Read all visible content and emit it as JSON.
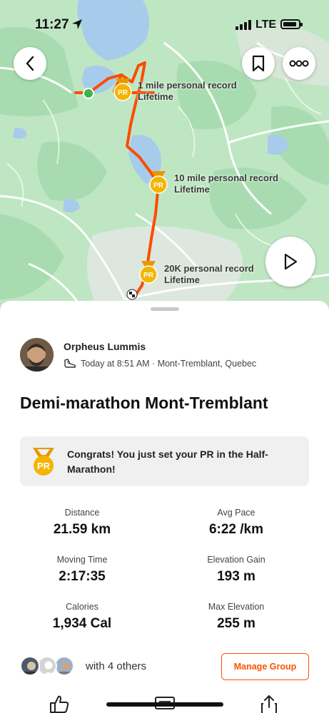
{
  "status_bar": {
    "time": "11:27",
    "network": "LTE"
  },
  "map": {
    "records": [
      {
        "title": "1 mile personal record",
        "subtitle": "Lifetime",
        "badge": "PR"
      },
      {
        "title": "10 mile personal record",
        "subtitle": "Lifetime",
        "badge": "PR"
      },
      {
        "title": "20K personal record",
        "subtitle": "Lifetime",
        "badge": "PR"
      }
    ],
    "icons": {
      "back": "chevron-left-icon",
      "save": "bookmark-icon",
      "more": "more-icon",
      "play": "play-icon"
    }
  },
  "activity": {
    "athlete": "Orpheus Lummis",
    "meta": "Today at 8:51 AM · Mont-Tremblant, Quebec",
    "title": "Demi-marathon Mont-Tremblant"
  },
  "pr_banner": {
    "badge": "PR",
    "message": "Congrats! You just set your PR in the Half-Marathon!"
  },
  "stats": [
    {
      "label": "Distance",
      "value": "21.59 km"
    },
    {
      "label": "Avg Pace",
      "value": "6:22 /km"
    },
    {
      "label": "Moving Time",
      "value": "2:17:35"
    },
    {
      "label": "Elevation Gain",
      "value": "193 m"
    },
    {
      "label": "Calories",
      "value": "1,934 Cal"
    },
    {
      "label": "Max Elevation",
      "value": "255 m"
    }
  ],
  "group": {
    "text": "with 4 others",
    "button": "Manage Group"
  },
  "colors": {
    "accent": "#fc5200",
    "pr_badge": "#f2a900",
    "map_land": "#b9e3c0",
    "map_water": "#a7cbea"
  }
}
